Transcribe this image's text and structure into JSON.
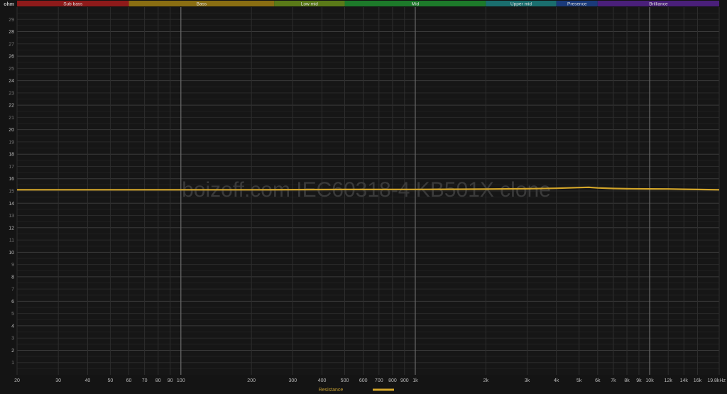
{
  "chart_data": {
    "type": "line",
    "title": "",
    "watermark": "boizoff.com IEC60318-4 KB501X clone",
    "ylabel": "ohm",
    "xlabel": "Hz",
    "xscale": "log",
    "xlim": [
      20,
      19800
    ],
    "ylim": [
      0,
      30
    ],
    "grid": true,
    "legend_placement": "bottom-center",
    "yticks": [
      1,
      2,
      3,
      4,
      5,
      6,
      7,
      8,
      9,
      10,
      11,
      12,
      13,
      14,
      15,
      16,
      17,
      18,
      19,
      20,
      21,
      22,
      23,
      24,
      25,
      26,
      27,
      28,
      29
    ],
    "xticks": [
      {
        "v": 20,
        "label": "20"
      },
      {
        "v": 30,
        "label": "30"
      },
      {
        "v": 40,
        "label": "40"
      },
      {
        "v": 50,
        "label": "50"
      },
      {
        "v": 60,
        "label": "60"
      },
      {
        "v": 70,
        "label": "70"
      },
      {
        "v": 80,
        "label": "80"
      },
      {
        "v": 90,
        "label": "90"
      },
      {
        "v": 100,
        "label": "100"
      },
      {
        "v": 200,
        "label": "200"
      },
      {
        "v": 300,
        "label": "300"
      },
      {
        "v": 400,
        "label": "400"
      },
      {
        "v": 500,
        "label": "500"
      },
      {
        "v": 600,
        "label": "600"
      },
      {
        "v": 700,
        "label": "700"
      },
      {
        "v": 800,
        "label": "800"
      },
      {
        "v": 900,
        "label": "900"
      },
      {
        "v": 1000,
        "label": "1k"
      },
      {
        "v": 2000,
        "label": "2k"
      },
      {
        "v": 3000,
        "label": "3k"
      },
      {
        "v": 4000,
        "label": "4k"
      },
      {
        "v": 5000,
        "label": "5k"
      },
      {
        "v": 6000,
        "label": "6k"
      },
      {
        "v": 7000,
        "label": "7k"
      },
      {
        "v": 8000,
        "label": "8k"
      },
      {
        "v": 9000,
        "label": "9k"
      },
      {
        "v": 10000,
        "label": "10k"
      },
      {
        "v": 12000,
        "label": "12k"
      },
      {
        "v": 14000,
        "label": "14k"
      },
      {
        "v": 16000,
        "label": "16k"
      },
      {
        "v": 19800,
        "label": "19.8kHz"
      }
    ],
    "bands": [
      {
        "name": "Sub bass",
        "from": 20,
        "to": 60,
        "color": "#8e1a1a"
      },
      {
        "name": "Bass",
        "from": 60,
        "to": 250,
        "color": "#8a6e12"
      },
      {
        "name": "Low mid",
        "from": 250,
        "to": 500,
        "color": "#5a7a18"
      },
      {
        "name": "Mid",
        "from": 500,
        "to": 2000,
        "color": "#1d7a2a"
      },
      {
        "name": "Upper mid",
        "from": 2000,
        "to": 4000,
        "color": "#1a6e6e"
      },
      {
        "name": "Presence",
        "from": 4000,
        "to": 6000,
        "color": "#1a3a7a"
      },
      {
        "name": "Brilliance",
        "from": 6000,
        "to": 20000,
        "color": "#4a1f7a"
      }
    ],
    "series": [
      {
        "name": "Resistance",
        "color": "#d4a62a",
        "x": [
          20,
          50,
          100,
          200,
          500,
          1000,
          2000,
          3000,
          4000,
          5000,
          5500,
          6000,
          7000,
          8000,
          10000,
          12000,
          14000,
          16000,
          19800
        ],
        "y": [
          15.1,
          15.1,
          15.1,
          15.1,
          15.12,
          15.13,
          15.15,
          15.18,
          15.22,
          15.28,
          15.3,
          15.25,
          15.2,
          15.18,
          15.17,
          15.16,
          15.14,
          15.12,
          15.1
        ]
      }
    ]
  }
}
